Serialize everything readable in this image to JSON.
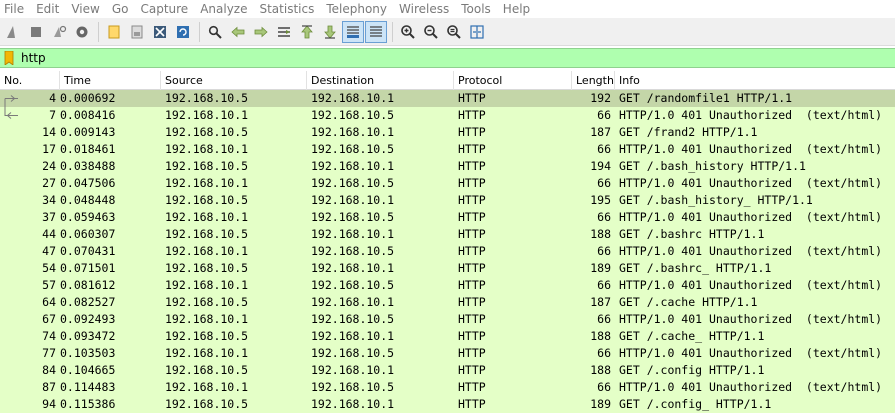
{
  "menu": [
    "File",
    "Edit",
    "View",
    "Go",
    "Capture",
    "Analyze",
    "Statistics",
    "Telephony",
    "Wireless",
    "Tools",
    "Help"
  ],
  "toolbar": {
    "icons": [
      "shark-fin-start-icon",
      "stop-square-icon",
      "restart-capture-icon",
      "capture-options-gear-icon",
      "open-file-icon",
      "save-file-icon",
      "close-file-icon",
      "reload-file-icon",
      "find-packet-icon",
      "go-back-icon",
      "go-forward-icon",
      "go-to-packet-icon",
      "go-first-packet-icon",
      "go-last-packet-icon",
      "auto-scroll-icon",
      "colorize-icon",
      "zoom-in-icon",
      "zoom-out-icon",
      "zoom-normal-icon",
      "resize-columns-icon"
    ],
    "active": [
      "auto-scroll-icon",
      "colorize-icon"
    ]
  },
  "filter": {
    "value": "http",
    "bg_color": "#afffaf"
  },
  "columns": {
    "no": "No.",
    "time": "Time",
    "source": "Source",
    "destination": "Destination",
    "protocol": "Protocol",
    "length": "Length",
    "info": "Info"
  },
  "colors": {
    "row_bg": "#e4ffc7",
    "selected_bg": "#c4d6a8"
  },
  "packets": [
    {
      "no": "4",
      "time": "0.000692",
      "source": "192.168.10.5",
      "destination": "192.168.10.1",
      "protocol": "HTTP",
      "length": "192",
      "info": "GET /randomfile1 HTTP/1.1",
      "selected": true,
      "related": "request"
    },
    {
      "no": "7",
      "time": "0.008416",
      "source": "192.168.10.1",
      "destination": "192.168.10.5",
      "protocol": "HTTP",
      "length": "66",
      "info": "HTTP/1.0 401 Unauthorized  (text/html)",
      "related": "response"
    },
    {
      "no": "14",
      "time": "0.009143",
      "source": "192.168.10.5",
      "destination": "192.168.10.1",
      "protocol": "HTTP",
      "length": "187",
      "info": "GET /frand2 HTTP/1.1"
    },
    {
      "no": "17",
      "time": "0.018461",
      "source": "192.168.10.1",
      "destination": "192.168.10.5",
      "protocol": "HTTP",
      "length": "66",
      "info": "HTTP/1.0 401 Unauthorized  (text/html)"
    },
    {
      "no": "24",
      "time": "0.038488",
      "source": "192.168.10.5",
      "destination": "192.168.10.1",
      "protocol": "HTTP",
      "length": "194",
      "info": "GET /.bash_history HTTP/1.1"
    },
    {
      "no": "27",
      "time": "0.047506",
      "source": "192.168.10.1",
      "destination": "192.168.10.5",
      "protocol": "HTTP",
      "length": "66",
      "info": "HTTP/1.0 401 Unauthorized  (text/html)"
    },
    {
      "no": "34",
      "time": "0.048448",
      "source": "192.168.10.5",
      "destination": "192.168.10.1",
      "protocol": "HTTP",
      "length": "195",
      "info": "GET /.bash_history_ HTTP/1.1"
    },
    {
      "no": "37",
      "time": "0.059463",
      "source": "192.168.10.1",
      "destination": "192.168.10.5",
      "protocol": "HTTP",
      "length": "66",
      "info": "HTTP/1.0 401 Unauthorized  (text/html)"
    },
    {
      "no": "44",
      "time": "0.060307",
      "source": "192.168.10.5",
      "destination": "192.168.10.1",
      "protocol": "HTTP",
      "length": "188",
      "info": "GET /.bashrc HTTP/1.1"
    },
    {
      "no": "47",
      "time": "0.070431",
      "source": "192.168.10.1",
      "destination": "192.168.10.5",
      "protocol": "HTTP",
      "length": "66",
      "info": "HTTP/1.0 401 Unauthorized  (text/html)"
    },
    {
      "no": "54",
      "time": "0.071501",
      "source": "192.168.10.5",
      "destination": "192.168.10.1",
      "protocol": "HTTP",
      "length": "189",
      "info": "GET /.bashrc_ HTTP/1.1"
    },
    {
      "no": "57",
      "time": "0.081612",
      "source": "192.168.10.1",
      "destination": "192.168.10.5",
      "protocol": "HTTP",
      "length": "66",
      "info": "HTTP/1.0 401 Unauthorized  (text/html)"
    },
    {
      "no": "64",
      "time": "0.082527",
      "source": "192.168.10.5",
      "destination": "192.168.10.1",
      "protocol": "HTTP",
      "length": "187",
      "info": "GET /.cache HTTP/1.1"
    },
    {
      "no": "67",
      "time": "0.092493",
      "source": "192.168.10.1",
      "destination": "192.168.10.5",
      "protocol": "HTTP",
      "length": "66",
      "info": "HTTP/1.0 401 Unauthorized  (text/html)"
    },
    {
      "no": "74",
      "time": "0.093472",
      "source": "192.168.10.5",
      "destination": "192.168.10.1",
      "protocol": "HTTP",
      "length": "188",
      "info": "GET /.cache_ HTTP/1.1"
    },
    {
      "no": "77",
      "time": "0.103503",
      "source": "192.168.10.1",
      "destination": "192.168.10.5",
      "protocol": "HTTP",
      "length": "66",
      "info": "HTTP/1.0 401 Unauthorized  (text/html)"
    },
    {
      "no": "84",
      "time": "0.104665",
      "source": "192.168.10.5",
      "destination": "192.168.10.1",
      "protocol": "HTTP",
      "length": "188",
      "info": "GET /.config HTTP/1.1"
    },
    {
      "no": "87",
      "time": "0.114483",
      "source": "192.168.10.1",
      "destination": "192.168.10.5",
      "protocol": "HTTP",
      "length": "66",
      "info": "HTTP/1.0 401 Unauthorized  (text/html)"
    },
    {
      "no": "94",
      "time": "0.115386",
      "source": "192.168.10.5",
      "destination": "192.168.10.1",
      "protocol": "HTTP",
      "length": "189",
      "info": "GET /.config_ HTTP/1.1"
    }
  ]
}
